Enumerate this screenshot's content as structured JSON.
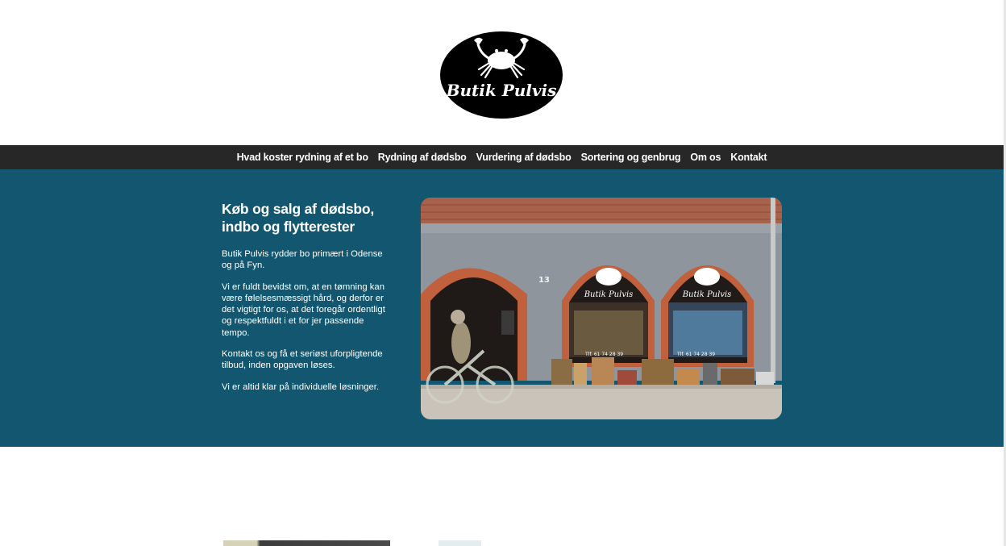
{
  "logo": {
    "brand_text": "Butik Pulvis"
  },
  "nav": {
    "items": [
      "Hvad koster rydning af et bo",
      "Rydning af dødsbo",
      "Vurdering af dødsbo",
      "Sortering og genbrug",
      "Om os",
      "Kontakt"
    ]
  },
  "hero": {
    "title": "Køb og salg af dødsbo, indbo og flytterester",
    "paragraphs": [
      "Butik Pulvis rydder bo primært i Odense og på Fyn.",
      "Vi er fuldt bevidst om, at en tømning kan være følelsesmæssigt hård, og derfor er det vigtigt for os, at det foregår ordentligt og respektfuldt i et for jer passende tempo.",
      "Kontakt os og få et seriøst uforpligtende tilbud, inden opgaven løses.",
      "Vi er altid klar på individuelle løsninger."
    ],
    "photo": {
      "house_number": "13",
      "window_sign": "Butik Pulvis",
      "phone_left": "Tlf. 61 74 28 39",
      "phone_right": "Tlf. 61 74 28 39"
    }
  },
  "colors": {
    "nav_bg": "#272727",
    "hero_bg": "#12576f",
    "text_on_dark": "#ffffff"
  }
}
